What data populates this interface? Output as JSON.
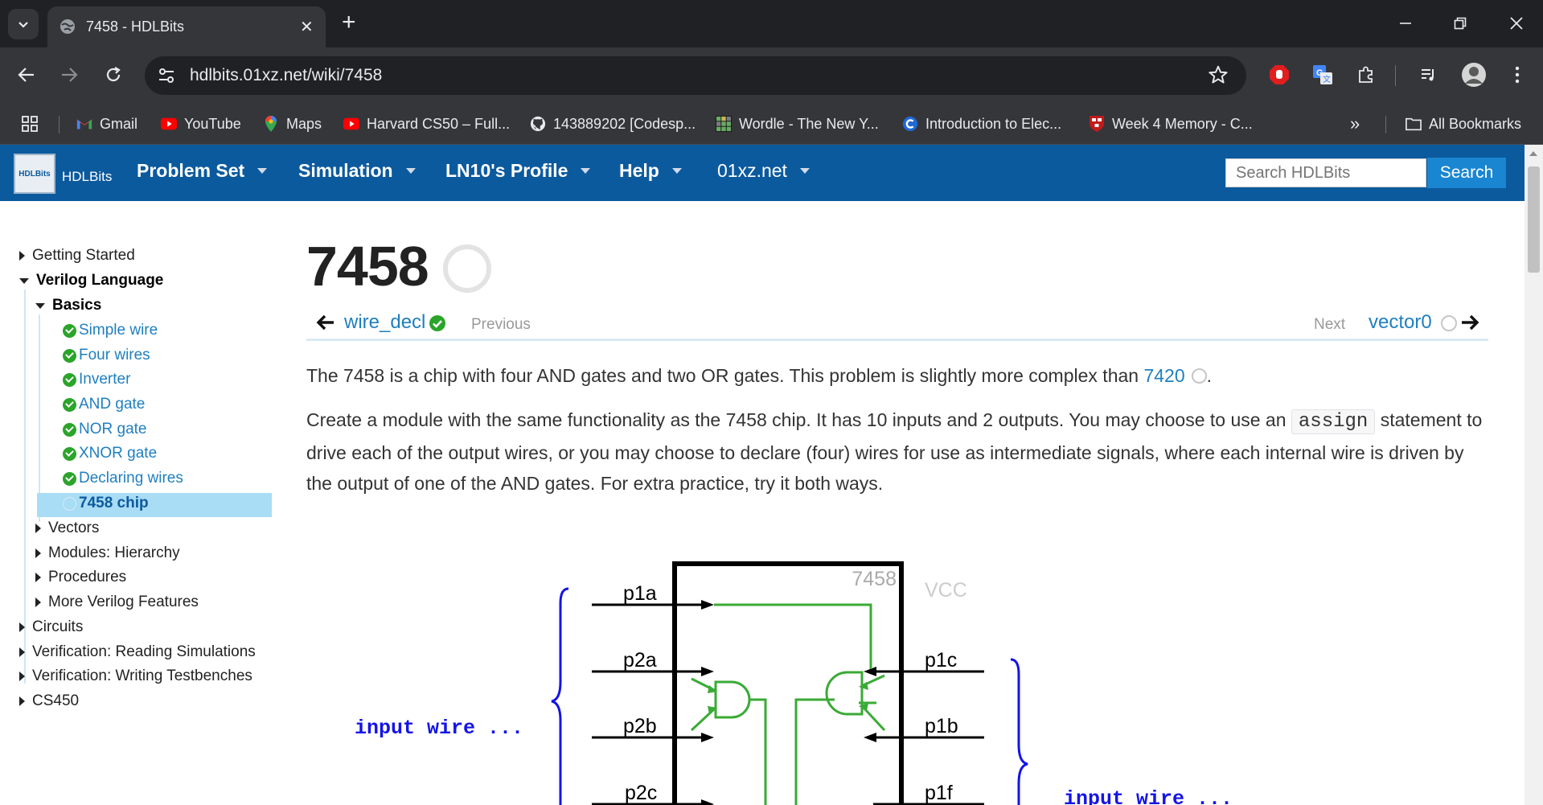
{
  "browser": {
    "tab_title": "7458 - HDLBits",
    "url": "hdlbits.01xz.net/wiki/7458",
    "bookmarks": [
      {
        "label": "Gmail",
        "icon": "gmail-icon"
      },
      {
        "label": "YouTube",
        "icon": "youtube-icon"
      },
      {
        "label": "Maps",
        "icon": "maps-icon"
      },
      {
        "label": "Harvard CS50 – Full...",
        "icon": "youtube-icon"
      },
      {
        "label": "143889202 [Codesp...",
        "icon": "github-icon"
      },
      {
        "label": "Wordle - The New Y...",
        "icon": "wordle-icon"
      },
      {
        "label": "Introduction to Elec...",
        "icon": "coursera-icon"
      },
      {
        "label": "Week 4 Memory - C...",
        "icon": "harvard-icon"
      }
    ],
    "overflow": "»",
    "all_bookmarks": "All Bookmarks",
    "colors": {
      "chrome_dark": "#202124",
      "chrome": "#35363a"
    }
  },
  "site": {
    "logo_text": "HDLBits",
    "brand": "HDLBits",
    "menu": [
      "Problem Set",
      "Simulation",
      "LN10's Profile",
      "Help",
      "01xz.net"
    ],
    "search_placeholder": "Search HDLBits",
    "search_button": "Search",
    "colors": {
      "header": "#0c5a9e",
      "link": "#1f7fbf",
      "done": "#2aa52a",
      "active": "#a9dcf5"
    }
  },
  "sidebar": {
    "getting_started": "Getting Started",
    "verilog_language": "Verilog Language",
    "basics": "Basics",
    "basics_items": [
      "Simple wire",
      "Four wires",
      "Inverter",
      "AND gate",
      "NOR gate",
      "XNOR gate",
      "Declaring wires"
    ],
    "active_item": "7458 chip",
    "subsections": [
      "Vectors",
      "Modules: Hierarchy",
      "Procedures",
      "More Verilog Features"
    ],
    "sections": [
      "Circuits",
      "Verification: Reading Simulations",
      "Verification: Writing Testbenches",
      "CS450"
    ]
  },
  "page": {
    "title": "7458",
    "prev_problem": "wire_decl",
    "prev_label": "Previous",
    "next_label": "Next",
    "next_problem": "vector0",
    "para1_text": "The 7458 is a chip with four AND gates and two OR gates. This problem is slightly more complex than",
    "para1_link": "7420",
    "para1_end": ".",
    "para2_a": "Create a module with the same functionality as the 7458 chip. It has 10 inputs and 2 outputs. You may choose to use an",
    "para2_code": "assign",
    "para2_b": "statement to drive each of the output wires, or you may choose to declare (four) wires for use as intermediate signals, where each internal wire is driven by the output of one of the AND gates. For extra practice, try it both ways."
  },
  "diagram": {
    "chip_label": "7458",
    "vcc": "VCC",
    "left_pins": [
      "p1a",
      "p2a",
      "p2b",
      "p2c"
    ],
    "right_pins": [
      "p1c",
      "p1b",
      "p1f"
    ],
    "left_note": "input wire ...",
    "right_note": "input wire ...",
    "colors": {
      "wire": "#3aaa35",
      "note": "#1414e6"
    }
  }
}
